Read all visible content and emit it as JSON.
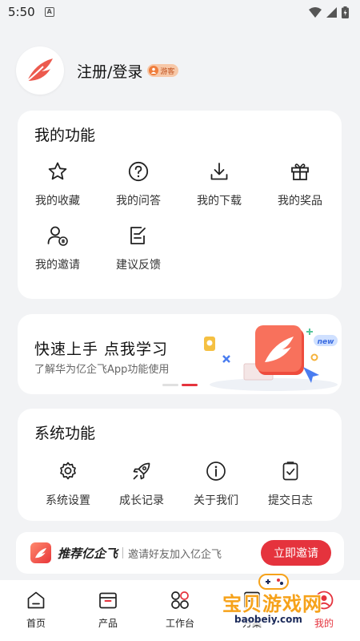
{
  "status_bar": {
    "time": "5:50",
    "notification_icon": "A"
  },
  "profile": {
    "login_label": "注册/登录",
    "guest_badge": "游客"
  },
  "my_functions": {
    "title": "我的功能",
    "items": [
      {
        "label": "我的收藏",
        "icon": "star-icon"
      },
      {
        "label": "我的问答",
        "icon": "question-icon"
      },
      {
        "label": "我的下载",
        "icon": "download-icon"
      },
      {
        "label": "我的奖品",
        "icon": "gift-icon"
      },
      {
        "label": "我的邀请",
        "icon": "invite-user-icon"
      },
      {
        "label": "建议反馈",
        "icon": "feedback-icon"
      }
    ]
  },
  "banner": {
    "title": "快速上手  点我学习",
    "subtitle": "了解华为亿企飞App功能使用",
    "new_tag": "new"
  },
  "system_functions": {
    "title": "系统功能",
    "items": [
      {
        "label": "系统设置",
        "icon": "gear-icon"
      },
      {
        "label": "成长记录",
        "icon": "rocket-icon"
      },
      {
        "label": "关于我们",
        "icon": "info-icon"
      },
      {
        "label": "提交日志",
        "icon": "log-icon"
      }
    ]
  },
  "invite": {
    "brand": "推荐亿企飞",
    "description": "邀请好友加入亿企飞",
    "button": "立即邀请"
  },
  "tabs": [
    {
      "label": "首页",
      "icon": "home-icon"
    },
    {
      "label": "产品",
      "icon": "product-icon"
    },
    {
      "label": "工作台",
      "icon": "workbench-icon"
    },
    {
      "label": "方案",
      "icon": "solution-icon"
    },
    {
      "label": "我的",
      "icon": "profile-icon",
      "active": true
    }
  ],
  "watermark": {
    "text": "宝贝游戏网",
    "url": "baobeiy.com"
  },
  "colors": {
    "accent": "#e5333d",
    "background": "#f2f3f5",
    "card": "#ffffff",
    "badge": "#f7c8a8"
  }
}
